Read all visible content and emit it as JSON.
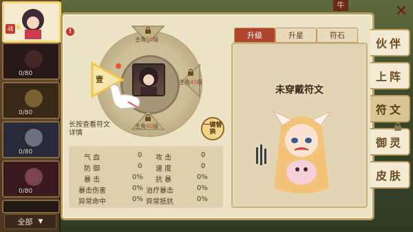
{
  "roster": {
    "cards": [
      {
        "level": ""
      },
      {
        "level": "0/80"
      },
      {
        "level": "0/80"
      },
      {
        "level": "0/80"
      },
      {
        "level": "0/80"
      },
      {
        "level": ""
      }
    ],
    "filter_label": "全部"
  },
  "rune_wheel": {
    "slots": [
      {
        "label_prefix": "主角",
        "level": "50",
        "label_suffix": "级"
      },
      {
        "label_prefix": "主角",
        "level": "45",
        "label_suffix": "级"
      },
      {
        "label_prefix": "主角",
        "level": "40",
        "label_suffix": "级"
      }
    ],
    "first_slot_label": "壹",
    "hint": "长按查看符文详情",
    "one_key_replace": "一键替换"
  },
  "stats": [
    {
      "label": "气 血",
      "value": "0",
      "label2": "攻 击",
      "value2": "0"
    },
    {
      "label": "防 御",
      "value": "0",
      "label2": "速 度",
      "value2": "0"
    },
    {
      "label": "暴 击",
      "value": "0%",
      "label2": "抗 暴",
      "value2": "0%"
    },
    {
      "label": "暴击伤害",
      "value": "0%",
      "label2": "治疗暴击",
      "value2": "0%"
    },
    {
      "label": "异常命中",
      "value": "0%",
      "label2": "异常抵抗",
      "value2": "0%"
    }
  ],
  "info_tabs": [
    "升级",
    "升星",
    "符石"
  ],
  "info_title": "未穿戴符文",
  "side_tabs": [
    "伙伴",
    "上阵",
    "符文",
    "御灵",
    "皮肤"
  ],
  "active_side_tab": "符文",
  "top_badge": "牛",
  "colors": {
    "active_tab": "#b0452e",
    "panel_bg": "#ece3c6",
    "accent_level": "#d24a2a"
  }
}
